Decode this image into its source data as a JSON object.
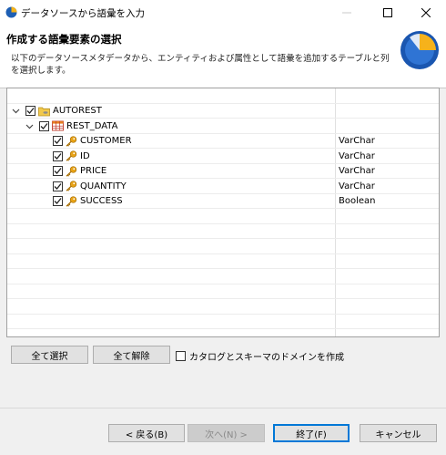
{
  "window": {
    "title": "データソースから語彙を入力"
  },
  "banner": {
    "title": "作成する語彙要素の選択",
    "description": "以下のデータソースメタデータから、エンティティおよび属性として語彙を追加するテーブルと列を選択します。"
  },
  "tree": {
    "root": {
      "label": "AUTOREST",
      "checked": true,
      "icon": "folder-database-icon"
    },
    "table": {
      "label": "REST_DATA",
      "checked": true,
      "icon": "table-icon"
    },
    "columns": [
      {
        "label": "CUSTOMER",
        "type": "VarChar",
        "checked": true,
        "icon": "key-icon"
      },
      {
        "label": "ID",
        "type": "VarChar",
        "checked": true,
        "icon": "key-icon"
      },
      {
        "label": "PRICE",
        "type": "VarChar",
        "checked": true,
        "icon": "key-icon"
      },
      {
        "label": "QUANTITY",
        "type": "VarChar",
        "checked": true,
        "icon": "key-icon"
      },
      {
        "label": "SUCCESS",
        "type": "Boolean",
        "checked": true,
        "icon": "key-icon"
      }
    ]
  },
  "actions": {
    "select_all": "全て選択",
    "deselect_all": "全て解除",
    "create_domain_label": "カタログとスキーマのドメインを作成",
    "create_domain_checked": false
  },
  "footer": {
    "back": "< 戻る(B)",
    "next": "次へ(N) >",
    "finish": "終了(F)",
    "cancel": "キャンセル"
  },
  "colors": {
    "accent": "#0078d7",
    "key_icon": "#e8a317",
    "folder_icon": "#f2c94c"
  }
}
